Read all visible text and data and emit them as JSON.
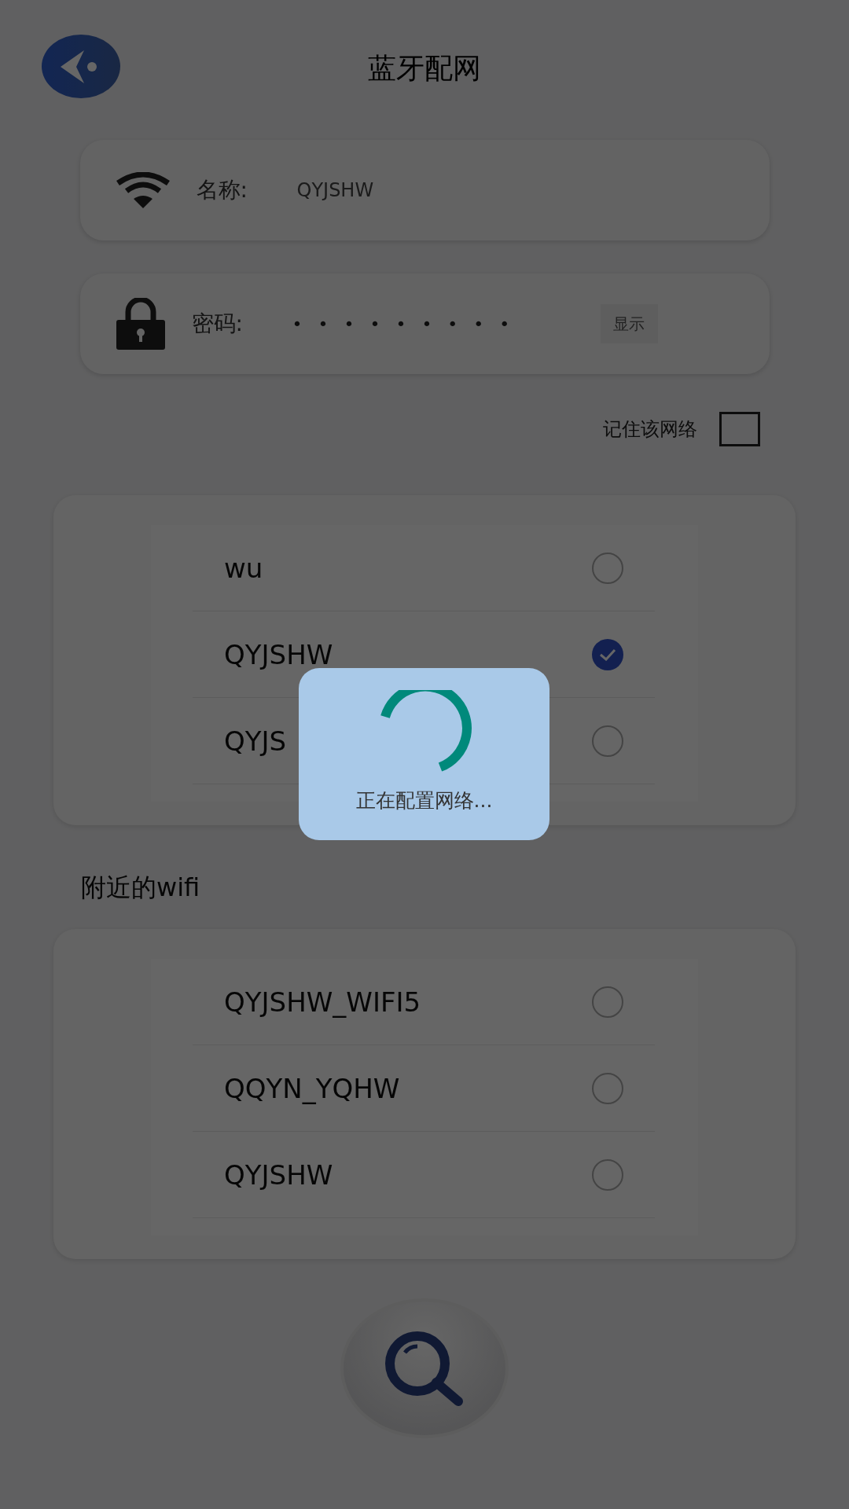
{
  "header": {
    "title": "蓝牙配网"
  },
  "name_field": {
    "label": "名称:",
    "value": "QYJSHW"
  },
  "password_field": {
    "label": "密码:",
    "value": "•••••••••",
    "show_button": "显示"
  },
  "remember": {
    "label": "记住该网络",
    "checked": false
  },
  "saved_networks": [
    {
      "name": "wu",
      "selected": false
    },
    {
      "name": "QYJSHW",
      "selected": true
    },
    {
      "name": "QYJS",
      "selected": false
    }
  ],
  "nearby_title": "附近的wifi",
  "nearby_networks": [
    {
      "name": "QYJSHW_WIFI5",
      "selected": false
    },
    {
      "name": "QQYN_YQHW",
      "selected": false
    },
    {
      "name": "QYJSHW",
      "selected": false
    }
  ],
  "dialog": {
    "message": "正在配置网络..."
  }
}
